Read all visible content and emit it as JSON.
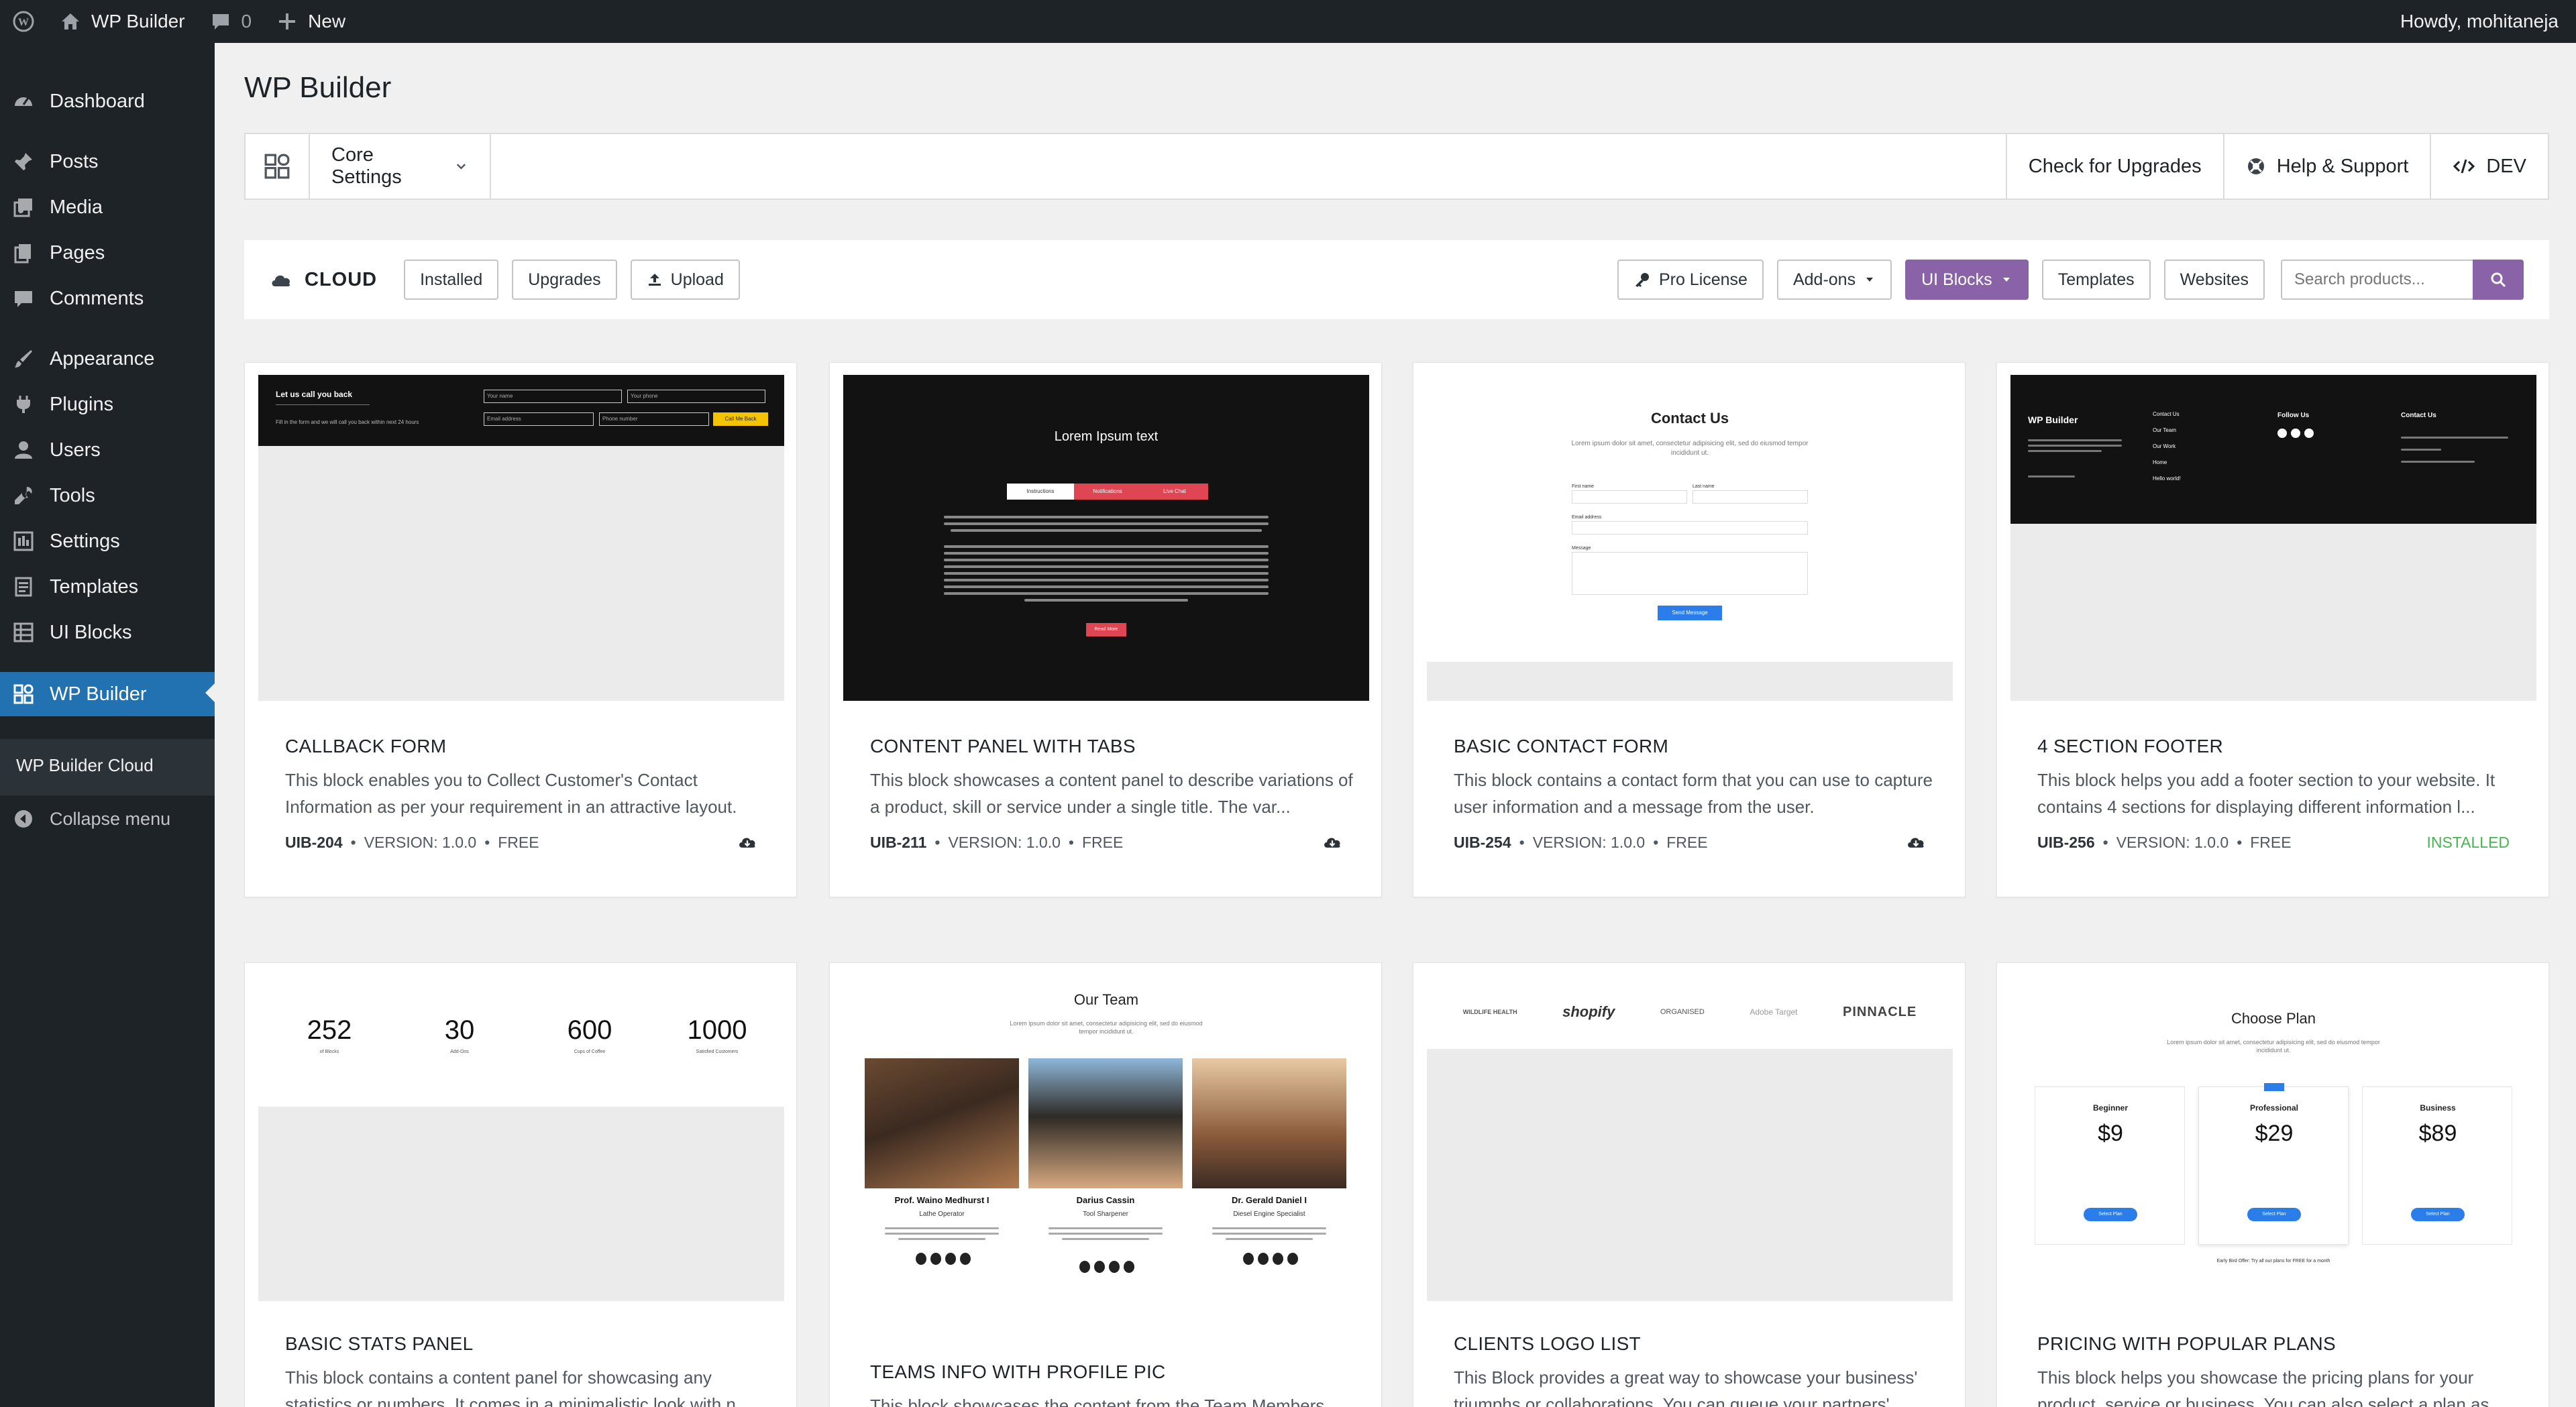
{
  "admin_bar": {
    "site_name": "WP Builder",
    "comments_count": "0",
    "new_label": "New",
    "greeting": "Howdy, mohitaneja"
  },
  "sidebar": {
    "items": [
      {
        "label": "Dashboard",
        "icon": "dashboard-icon"
      },
      {
        "label": "Posts",
        "icon": "pin-icon"
      },
      {
        "label": "Media",
        "icon": "media-icon"
      },
      {
        "label": "Pages",
        "icon": "pages-icon"
      },
      {
        "label": "Comments",
        "icon": "comment-icon"
      },
      {
        "label": "Appearance",
        "icon": "brush-icon"
      },
      {
        "label": "Plugins",
        "icon": "plugin-icon"
      },
      {
        "label": "Users",
        "icon": "user-icon"
      },
      {
        "label": "Tools",
        "icon": "wrench-icon"
      },
      {
        "label": "Settings",
        "icon": "settings-icon"
      },
      {
        "label": "Templates",
        "icon": "templates-icon"
      },
      {
        "label": "UI Blocks",
        "icon": "blocks-icon"
      },
      {
        "label": "WP Builder",
        "icon": "wpbuilder-icon",
        "active": true
      }
    ],
    "submenu": {
      "label": "WP Builder Cloud"
    },
    "collapse_label": "Collapse menu"
  },
  "page": {
    "title": "WP Builder"
  },
  "topbar": {
    "core_settings": "Core Settings",
    "check_upgrades": "Check for Upgrades",
    "help_support": "Help & Support",
    "dev": "DEV"
  },
  "filterbar": {
    "cloud": "CLOUD",
    "installed": "Installed",
    "upgrades": "Upgrades",
    "upload": "Upload",
    "pro_license": "Pro License",
    "addons": "Add-ons",
    "ui_blocks": "UI Blocks",
    "templates": "Templates",
    "websites": "Websites",
    "search_placeholder": "Search products..."
  },
  "colors": {
    "accent_purple": "#8a62a8",
    "wp_blue": "#2271b1",
    "installed_green": "#46b450"
  },
  "cards": [
    {
      "title": "CALLBACK FORM",
      "desc": "This block enables you to Collect Customer's Contact Information as per your requirement in an attractive layout.",
      "id": "UIB-204",
      "version": "VERSION: 1.0.0",
      "price": "FREE",
      "status": "cloud-download-icon"
    },
    {
      "title": "CONTENT PANEL WITH TABS",
      "desc": "This block showcases a content panel to describe variations of a product, skill or service under a single title. The var...",
      "id": "UIB-211",
      "version": "VERSION: 1.0.0",
      "price": "FREE",
      "status": "cloud-download-icon"
    },
    {
      "title": "BASIC CONTACT FORM",
      "desc": "This block contains a contact form that you can use to capture user information and a message from the user.",
      "id": "UIB-254",
      "version": "VERSION: 1.0.0",
      "price": "FREE",
      "status": "cloud-download-icon"
    },
    {
      "title": "4 SECTION FOOTER",
      "desc": "This block helps you add a footer section to your website. It contains 4 sections for displaying different information l...",
      "id": "UIB-256",
      "version": "VERSION: 1.0.0",
      "price": "FREE",
      "status_text": "INSTALLED"
    },
    {
      "title": "BASIC STATS PANEL",
      "desc": "This block contains a content panel for showcasing any statistics or numbers. It comes in a minimalistic look with n..."
    },
    {
      "title": "TEAMS INFO WITH PROFILE PIC",
      "desc": "This block showcases the content from the Team Members..."
    },
    {
      "title": "CLIENTS LOGO LIST",
      "desc": "This Block provides a great way to showcase your business' triumphs or collaborations. You can queue your partners'..."
    },
    {
      "title": "PRICING WITH POPULAR PLANS",
      "desc": "This block helps you showcase the pricing plans for your product, service or business. You can also select a plan as..."
    }
  ],
  "thumbs": {
    "callback": {
      "heading": "Let us call you back",
      "sub": "Fill in the form and we will call you back within next 24 hours",
      "f1": "Your name",
      "f2": "Your phone",
      "f3": "Email address",
      "f4": "Phone number",
      "btn": "Call Me Back"
    },
    "tabs": {
      "heading": "Lorem Ipsum text",
      "tab1": "Instructions",
      "tab2": "Notifications",
      "tab3": "Live Chat",
      "btn": "Read More"
    },
    "contact": {
      "heading": "Contact Us",
      "sub": "Lorem ipsum dolor sit amet, consectetur adipisicing elit, sed do eiusmod tempor incididunt ut.",
      "first": "First name",
      "last": "Last name",
      "email": "Email address",
      "message": "Message",
      "btn": "Send Message"
    },
    "footer": {
      "brand": "WP Builder",
      "col2": [
        "Contact Us",
        "Our Team",
        "Our Work",
        "Home",
        "Hello world!"
      ],
      "follow": "Follow Us",
      "contact": "Contact Us"
    },
    "stats": [
      {
        "num": "252",
        "label": "of Blocks"
      },
      {
        "num": "30",
        "label": "Add-Ons"
      },
      {
        "num": "600",
        "label": "Cups of Coffee"
      },
      {
        "num": "1000",
        "label": "Satisfied Customers"
      }
    ],
    "team": {
      "heading": "Our Team",
      "sub": "Lorem ipsum dolor sit amet, consectetur adipisicing elit, sed do eiusmod tempor incididunt ut.",
      "members": [
        {
          "name": "Prof. Waino Medhurst I",
          "role": "Lathe Operator"
        },
        {
          "name": "Darius Cassin",
          "role": "Tool Sharpener"
        },
        {
          "name": "Dr. Gerald Daniel I",
          "role": "Diesel Engine Specialist"
        }
      ]
    },
    "logos": [
      "WILDLIFE HEALTH",
      "shopify",
      "ORGANISED",
      "Adobe Target",
      "PINNACLE"
    ],
    "pricing": {
      "heading": "Choose Plan",
      "sub": "Lorem ipsum dolor sit amet, consectetur adipisicing elit, sed do eiusmod tempor incididunt ut.",
      "plans": [
        {
          "name": "Beginner",
          "price": "$9"
        },
        {
          "name": "Professional",
          "price": "$29"
        },
        {
          "name": "Business",
          "price": "$89"
        }
      ],
      "btn": "Select Plan",
      "note": "Early Bird Offer: Try all our plans for FREE for a month"
    }
  }
}
